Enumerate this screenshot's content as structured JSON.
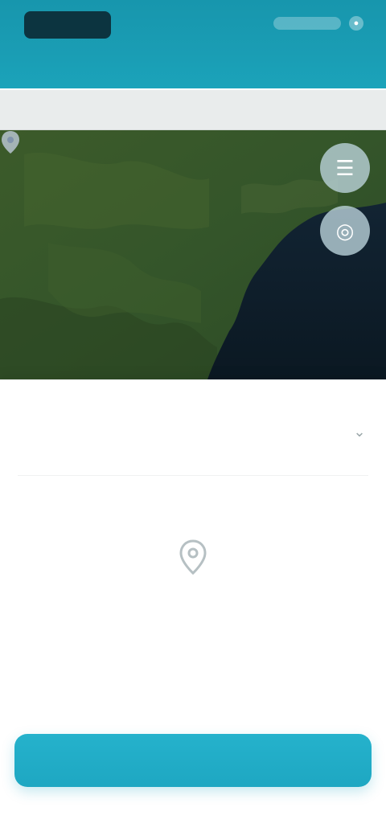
{
  "header": {
    "logo_text": "",
    "link_label": "",
    "tab_label": ""
  },
  "search": {
    "value": "",
    "placeholder": ""
  },
  "map": {
    "label": ""
  },
  "sheet": {
    "title": "",
    "empty_text": ""
  },
  "actions": {
    "primary_label": ""
  },
  "icons": {
    "logo": "brand-logo",
    "header": [
      "user-icon"
    ],
    "map_controls": [
      "layers-icon",
      "locate-icon"
    ],
    "marker": "map-pin-icon",
    "sheet_toggle": "chevron-down-icon",
    "empty_state": "map-pin-icon"
  },
  "colors": {
    "header": "#1a9db4",
    "accent": "#1ea7c2",
    "map_vegetation": "#2f4d22",
    "map_water": "#0c1a24",
    "search_bg": "#e9ecec"
  }
}
